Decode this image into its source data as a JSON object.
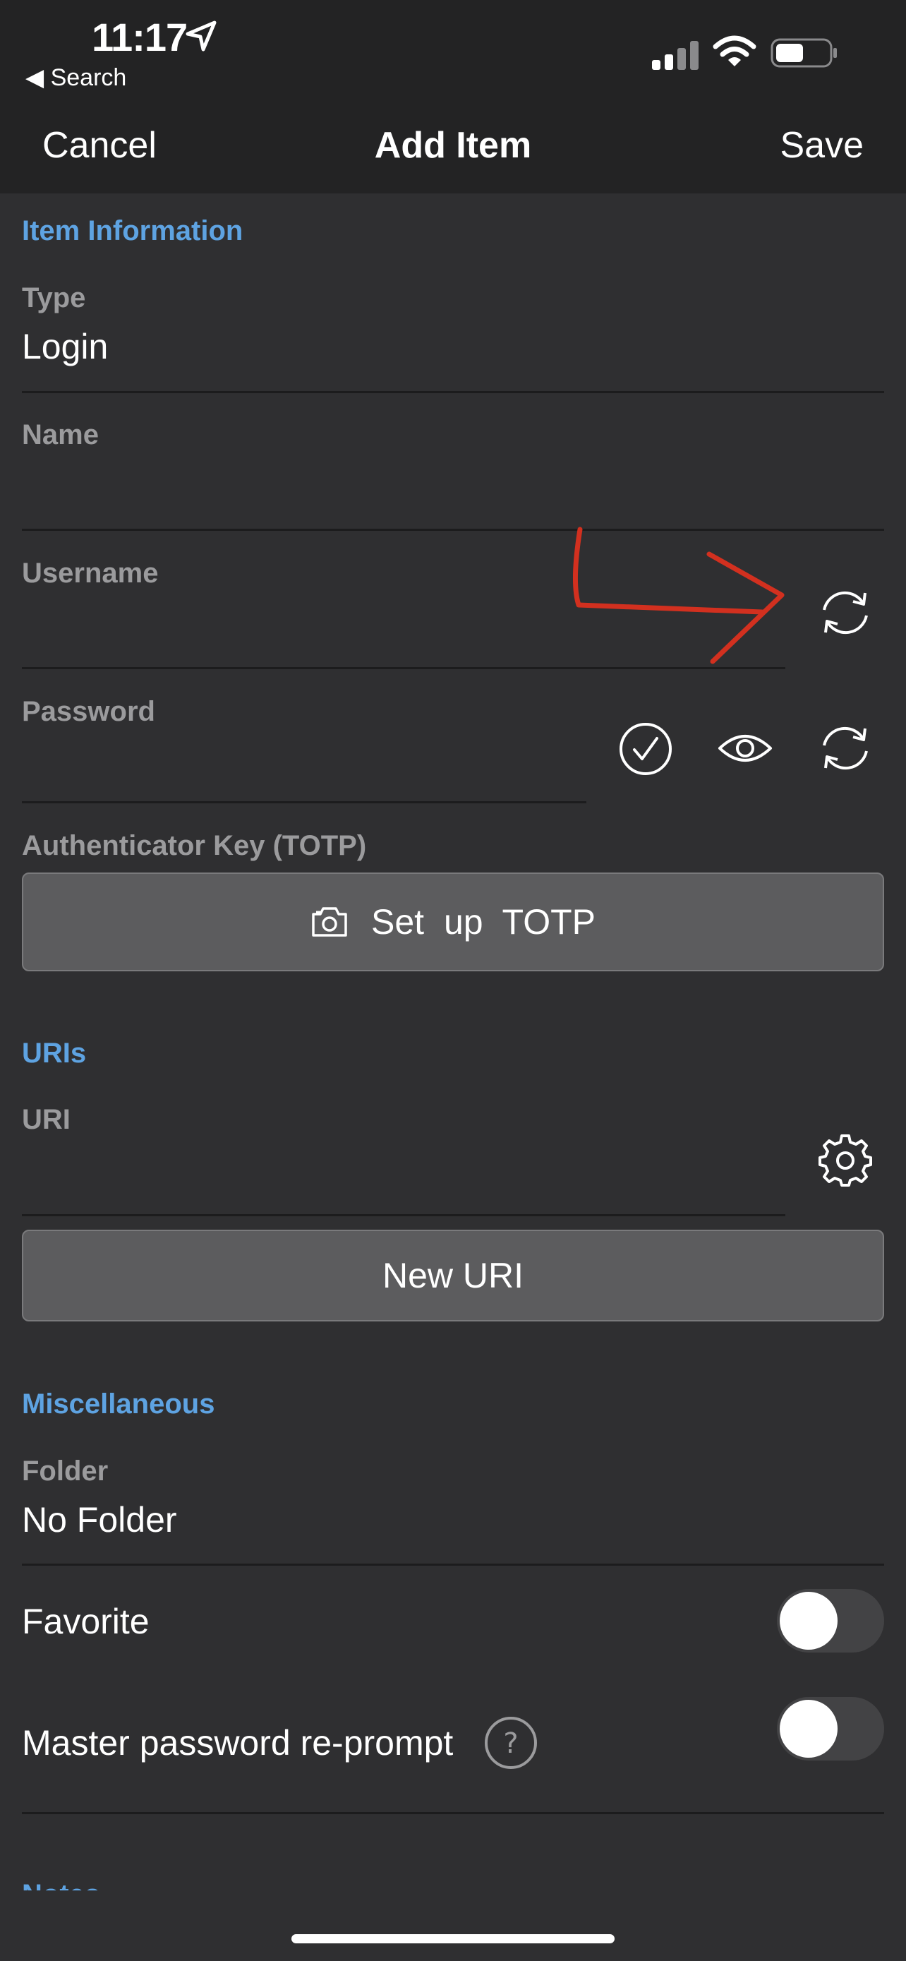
{
  "status_bar": {
    "time": "11:17",
    "back_label": "◀ Search"
  },
  "nav": {
    "cancel": "Cancel",
    "title": "Add Item",
    "save": "Save"
  },
  "item_info": {
    "section_title": "Item Information",
    "type_label": "Type",
    "type_value": "Login",
    "name_label": "Name",
    "name_value": "",
    "username_label": "Username",
    "username_value": "",
    "password_label": "Password",
    "password_value": "",
    "totp_label": "Authenticator Key (TOTP)",
    "totp_button": "Set up TOTP"
  },
  "uris": {
    "section_title": "URIs",
    "uri_label": "URI",
    "uri_value": "",
    "new_uri_button": "New URI"
  },
  "misc": {
    "section_title": "Miscellaneous",
    "folder_label": "Folder",
    "folder_value": "No Folder",
    "favorite_label": "Favorite",
    "favorite_on": false,
    "reprompt_label": "Master password re-prompt",
    "reprompt_on": false
  },
  "notes": {
    "section_title": "Notes"
  },
  "colors": {
    "accent": "#5ea3e2",
    "annotation": "#d2301f"
  }
}
